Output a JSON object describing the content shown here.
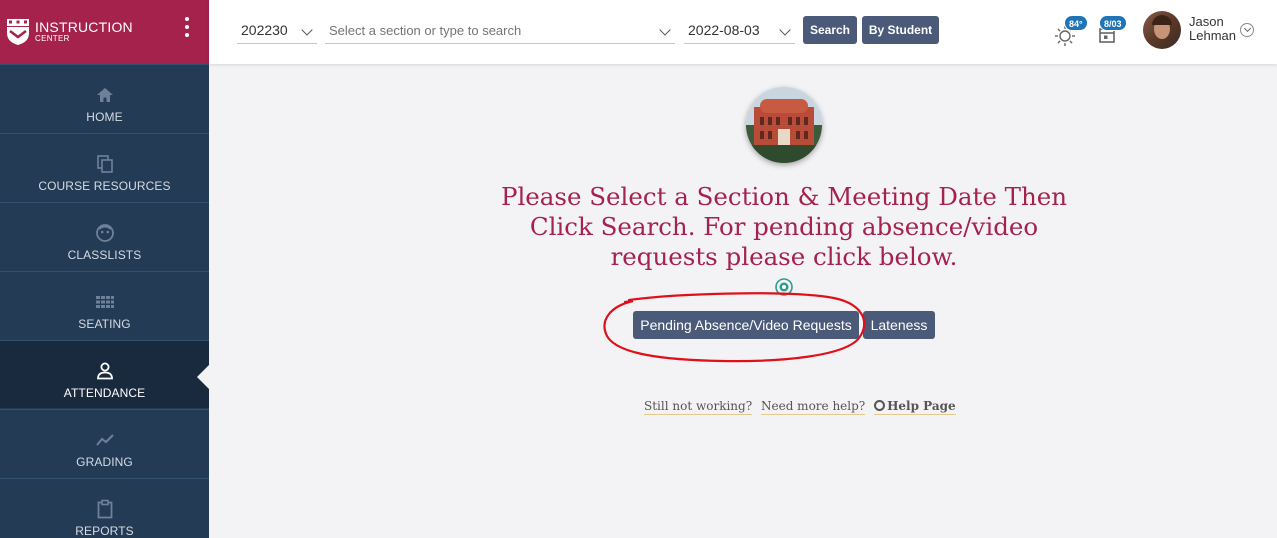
{
  "brand": {
    "title": "INSTRUCTION",
    "subtitle": "CENTER"
  },
  "nav": [
    {
      "label": "HOME",
      "icon": "home-icon"
    },
    {
      "label": "COURSE RESOURCES",
      "icon": "copy-icon"
    },
    {
      "label": "CLASSLISTS",
      "icon": "face-icon"
    },
    {
      "label": "SEATING",
      "icon": "grid-icon"
    },
    {
      "label": "ATTENDANCE",
      "icon": "person-icon",
      "active": true
    },
    {
      "label": "GRADING",
      "icon": "trend-icon"
    },
    {
      "label": "REPORTS",
      "icon": "clipboard-icon"
    }
  ],
  "header": {
    "term": "202230",
    "section_placeholder": "Select a section or type to search",
    "date": "2022-08-03",
    "search_label": "Search",
    "by_student_label": "By Student",
    "weather_badge": "84°",
    "calendar_badge": "8/03",
    "user_first": "Jason",
    "user_last": "Lehman"
  },
  "main": {
    "headline": "Please Select a Section & Meeting Date Then Click Search. For pending absence/video requests please click below.",
    "pending_label": "Pending Absence/Video Requests",
    "lateness_label": "Lateness",
    "help_still": "Still not working?",
    "help_more": "Need more help?",
    "help_page": "Help Page"
  },
  "colors": {
    "brand": "#a5224c",
    "sidebar": "#243b55",
    "button": "#4a5a78",
    "badge": "#1f73b7",
    "annotation": "#e0101a"
  }
}
